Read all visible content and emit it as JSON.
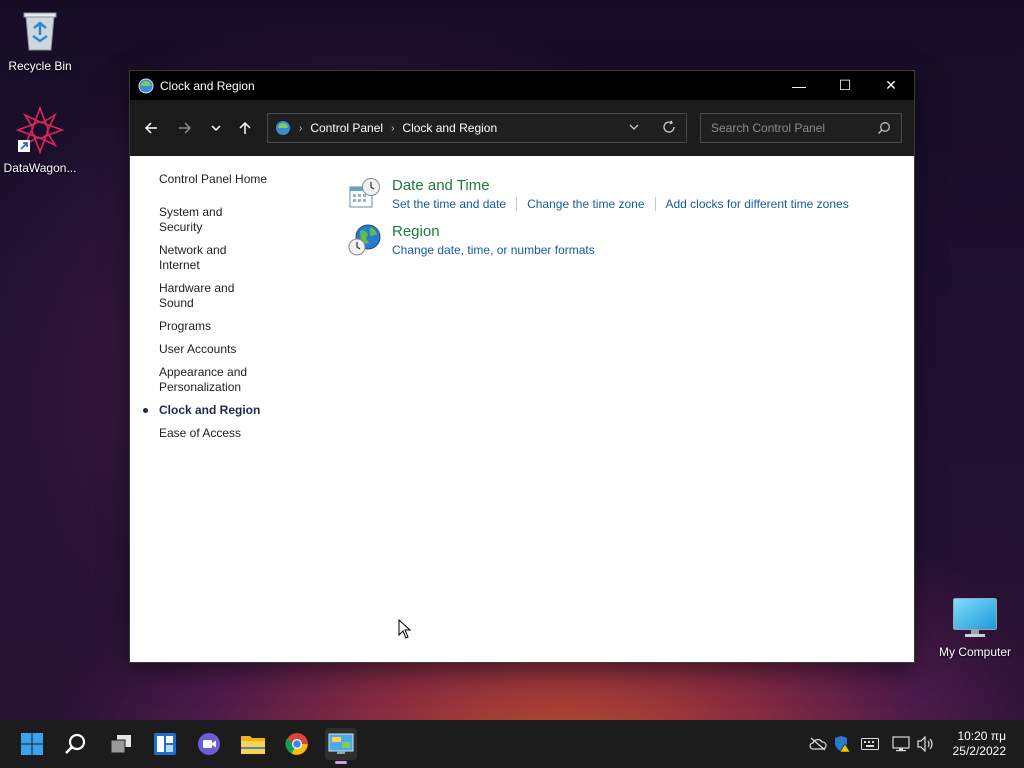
{
  "desktop": {
    "icons": [
      {
        "label": "Recycle Bin"
      },
      {
        "label": "DataWagon..."
      },
      {
        "label": "My Computer"
      }
    ]
  },
  "window": {
    "title": "Clock and Region",
    "controls": {
      "minimize": "—",
      "maximize": "☐",
      "close": "✕"
    }
  },
  "navbar": {
    "breadcrumb": [
      "Control Panel",
      "Clock and Region"
    ],
    "search_placeholder": "Search Control Panel"
  },
  "sidebar": {
    "home": "Control Panel Home",
    "items": [
      {
        "label": "System and Security"
      },
      {
        "label": "Network and Internet"
      },
      {
        "label": "Hardware and Sound"
      },
      {
        "label": "Programs"
      },
      {
        "label": "User Accounts"
      },
      {
        "label": "Appearance and Personalization"
      },
      {
        "label": "Clock and Region",
        "active": true
      },
      {
        "label": "Ease of Access"
      }
    ]
  },
  "categories": [
    {
      "title": "Date and Time",
      "icon": "calendar-clock-icon",
      "links": [
        "Set the time and date",
        "Change the time zone",
        "Add clocks for different time zones"
      ]
    },
    {
      "title": "Region",
      "icon": "globe-clock-icon",
      "links": [
        "Change date, time, or number formats"
      ]
    }
  ],
  "taskbar": {
    "time": "10:20 πμ",
    "date": "25/2/2022"
  },
  "colors": {
    "title_bar": "#000000",
    "nav_bar": "#1b1b1b",
    "category_title": "#1e7a3a",
    "link": "#1a5aa0",
    "taskbar": "#1c1c1c"
  }
}
